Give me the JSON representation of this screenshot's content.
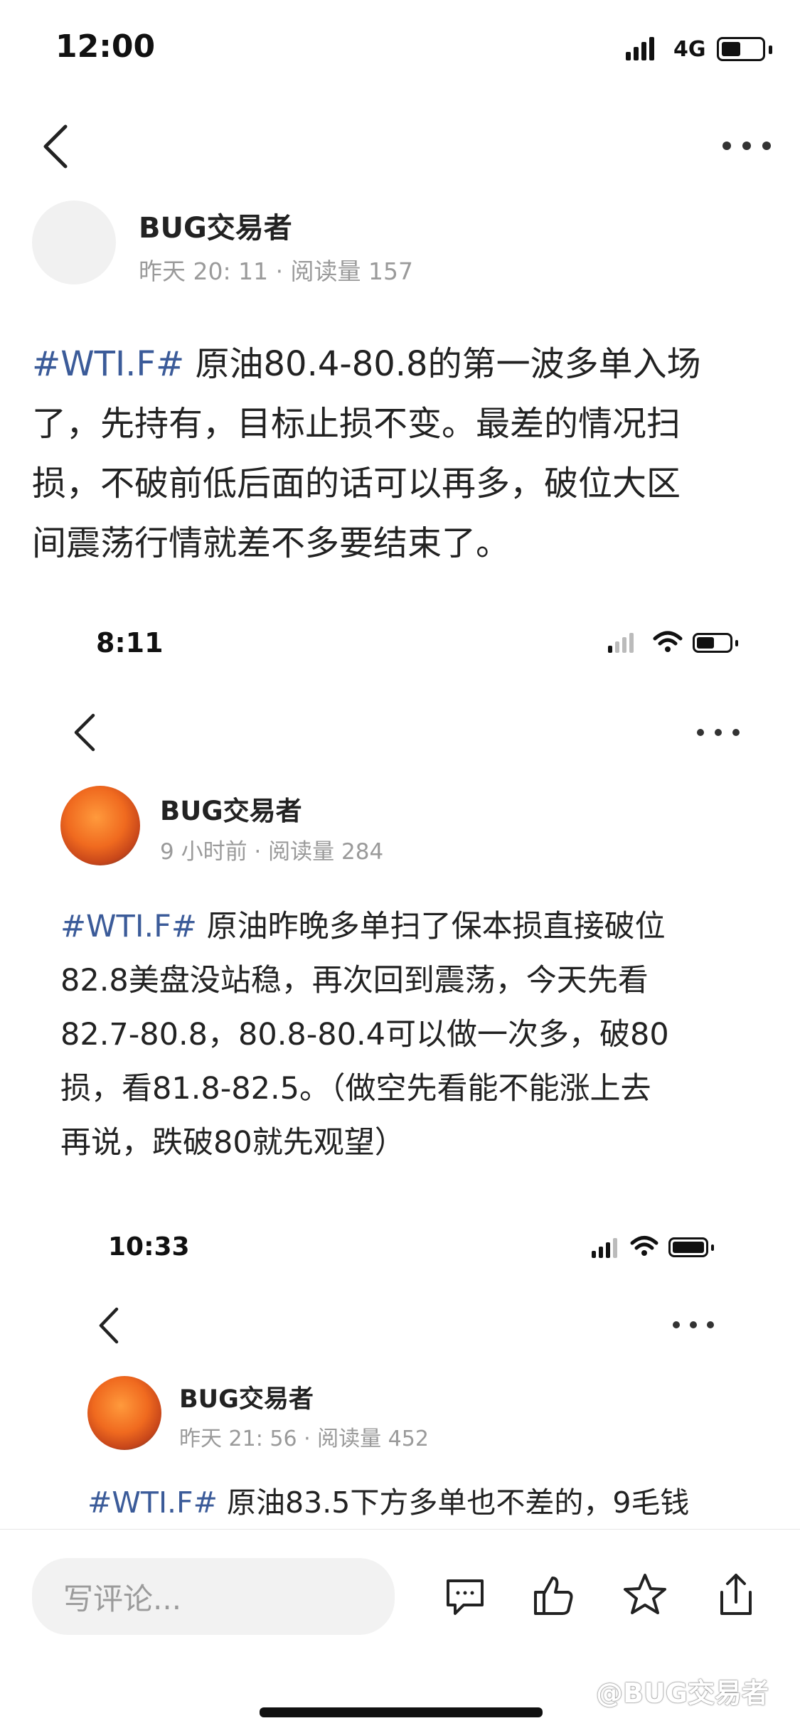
{
  "status_bar": {
    "time": "12:00",
    "network": "4G"
  },
  "post": {
    "author": "BUG交易者",
    "meta": "昨天 20: 11 · 阅读量 157",
    "hashtag": "#WTI.F#",
    "lines": [
      " 原油80.4-80.8的第一波多单入场",
      "了，先持有，目标止损不变。最差的情况扫",
      "损，不破前低后面的话可以再多，破位大区",
      "间震荡行情就差不多要结束了。"
    ]
  },
  "screenshot_1": {
    "time": "8:11",
    "author": "BUG交易者",
    "meta": "9 小时前 · 阅读量 284",
    "hashtag": "#WTI.F#",
    "lines": [
      " 原油昨晚多单扫了保本损直接破位",
      "82.8美盘没站稳，再次回到震荡，今天先看",
      "82.7-80.8，80.8-80.4可以做一次多，破80",
      "损，看81.8-82.5。（做空先看能不能涨上去",
      "再说，跌破80就先观望）"
    ]
  },
  "screenshot_2": {
    "time": "10:33",
    "author": "BUG交易者",
    "meta": "昨天 21: 56 · 阅读量 452",
    "hashtag": "#WTI.F#",
    "line": " 原油83.5下方多单也不差的，9毛钱"
  },
  "bottom_bar": {
    "comment_placeholder": "写评论...",
    "icons": [
      "comment-icon",
      "like-icon",
      "star-icon",
      "share-icon"
    ]
  },
  "watermark": "@BUG交易者",
  "colors": {
    "hashtag": "#3b5b99",
    "meta": "#9a9a9a",
    "text": "#222222"
  }
}
